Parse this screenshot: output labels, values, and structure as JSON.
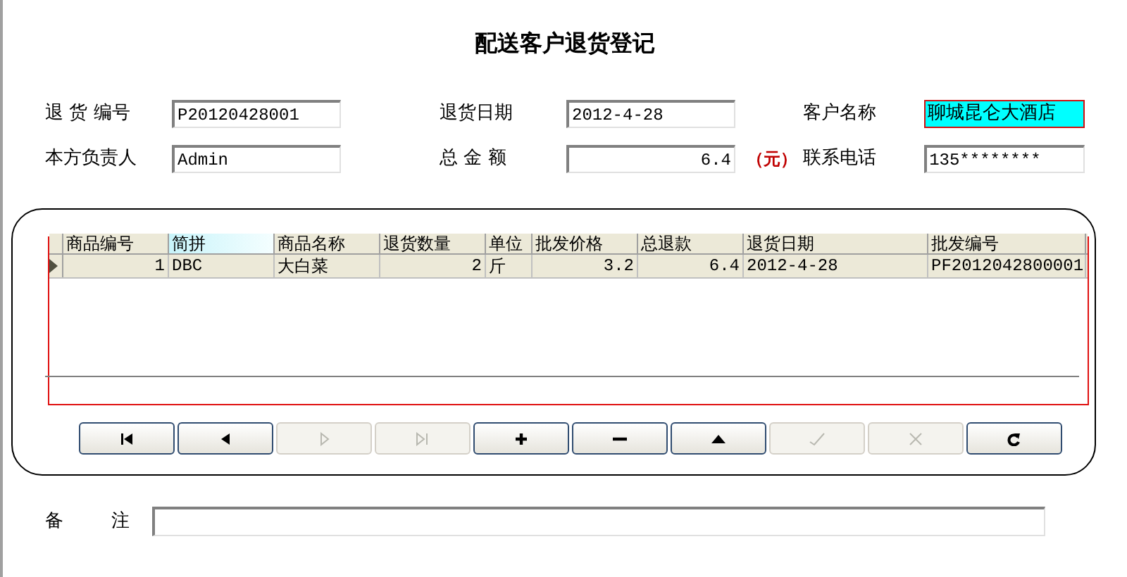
{
  "title": "配送客户退货登记",
  "fields": [
    {
      "label": "退 货 编号",
      "value": "P20120428001",
      "kind": "text",
      "highlighted": false
    },
    {
      "label": "退货日期",
      "value": "2012-4-28",
      "kind": "text",
      "highlighted": false
    },
    {
      "label": "客户名称",
      "value": "聊城昆仑大酒店",
      "kind": "text",
      "highlighted": true
    },
    {
      "label": "本方负责人",
      "value": "Admin",
      "kind": "text",
      "highlighted": false
    },
    {
      "label": "总 金 额",
      "value": "6.4",
      "kind": "amount",
      "highlighted": false,
      "unit": "（元）"
    },
    {
      "label": "联系电话",
      "value": "135********",
      "kind": "text",
      "highlighted": false
    }
  ],
  "table": {
    "columns": [
      {
        "label": "商品编号",
        "highlighted": false
      },
      {
        "label": "简拼",
        "highlighted": true
      },
      {
        "label": "商品名称",
        "highlighted": false
      },
      {
        "label": "退货数量",
        "highlighted": false
      },
      {
        "label": "单位",
        "highlighted": false
      },
      {
        "label": "批发价格",
        "highlighted": false
      },
      {
        "label": "总退款",
        "highlighted": false
      },
      {
        "label": "退货日期",
        "highlighted": false
      },
      {
        "label": "批发编号",
        "highlighted": false
      }
    ],
    "rows": [
      {
        "selected": true,
        "cells": [
          "1",
          "DBC",
          "大白菜",
          "2",
          "斤",
          "3.2",
          "6.4",
          "2012-4-28",
          "PF2012042800001"
        ]
      }
    ]
  },
  "buttons": [
    {
      "kind": "first",
      "disabled": false
    },
    {
      "kind": "prev",
      "disabled": false
    },
    {
      "kind": "next",
      "disabled": true
    },
    {
      "kind": "last",
      "disabled": true
    },
    {
      "kind": "add",
      "disabled": false
    },
    {
      "kind": "delete",
      "disabled": false
    },
    {
      "kind": "up",
      "disabled": false
    },
    {
      "kind": "save",
      "disabled": true
    },
    {
      "kind": "cancel",
      "disabled": true
    },
    {
      "kind": "refresh",
      "disabled": false
    }
  ],
  "remarks": {
    "label": "备 注"
  }
}
